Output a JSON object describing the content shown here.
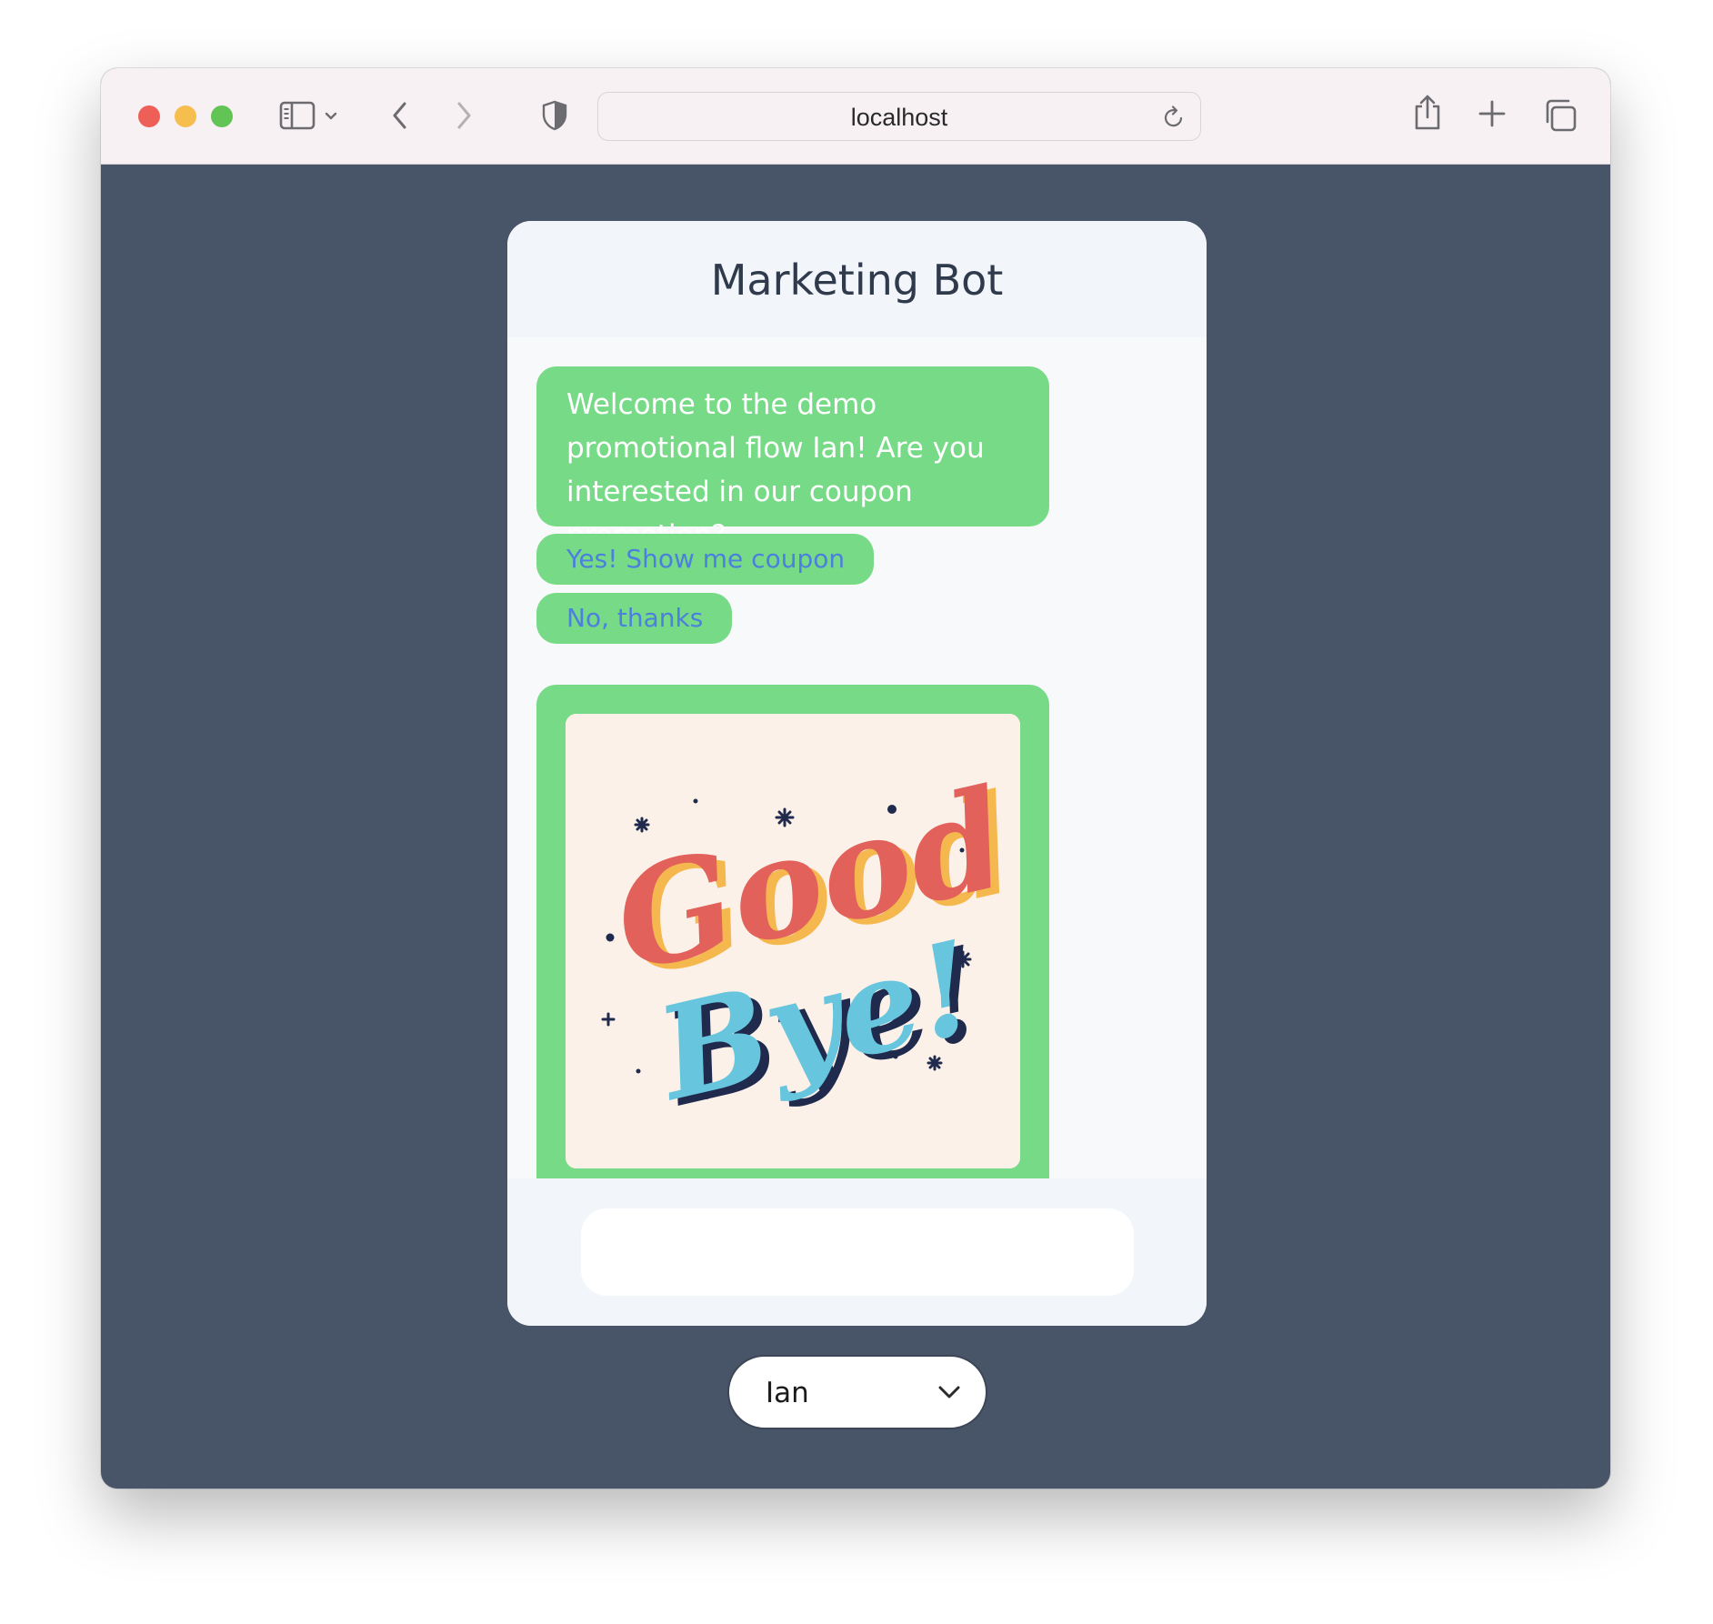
{
  "browser": {
    "url": "localhost",
    "icons": {
      "sidebar": "sidebar-icon",
      "sidebar_menu": "chevron-down-icon",
      "back": "chevron-left-icon",
      "forward": "chevron-right-icon",
      "privacy": "shield-icon",
      "reload": "reload-icon",
      "share": "share-icon",
      "new_tab": "plus-icon",
      "tabs": "tabs-overview-icon"
    }
  },
  "chat": {
    "title": "Marketing Bot",
    "messages": [
      {
        "type": "text",
        "text": "Welcome to the demo promotional flow Ian! Are you interested in our coupon promotion?"
      },
      {
        "type": "image",
        "image": "good-bye-lettering-image"
      }
    ],
    "quick_replies": [
      {
        "label": "Yes! Show me coupon"
      },
      {
        "label": "No, thanks"
      }
    ],
    "input": {
      "value": "",
      "placeholder": ""
    }
  },
  "user_select": {
    "selected": "Ian",
    "icon": "chevron-down-icon"
  },
  "colors": {
    "page_background": "#485467",
    "bot_bubble": "#77da87",
    "quick_reply_text": "#4b80dc",
    "chat_header": "#f2f5f9",
    "title_text": "#2f3a4c",
    "image_background": "#fcf1e9",
    "lettering_red": "#e2615b",
    "lettering_yellow": "#f5b84e",
    "lettering_blue": "#67c6dd",
    "lettering_navy": "#1f2a4d"
  }
}
